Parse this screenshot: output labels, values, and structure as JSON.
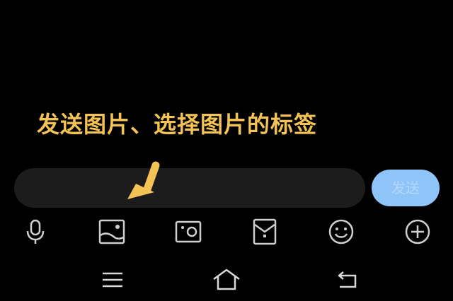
{
  "annotation": {
    "caption": "发送图片、选择图片的标签",
    "caption_color": "#f4c356"
  },
  "message_input": {
    "value": "",
    "background": "#1c1c1c"
  },
  "send_button": {
    "label": "发送",
    "color": "#8fc4f8"
  },
  "toolbar": {
    "icons": [
      "microphone-icon",
      "image-icon",
      "camera-icon",
      "red-packet-icon",
      "emoji-icon",
      "plus-icon"
    ]
  },
  "navigation_bar": {
    "icons": [
      "menu-icon",
      "home-icon",
      "back-icon"
    ]
  }
}
